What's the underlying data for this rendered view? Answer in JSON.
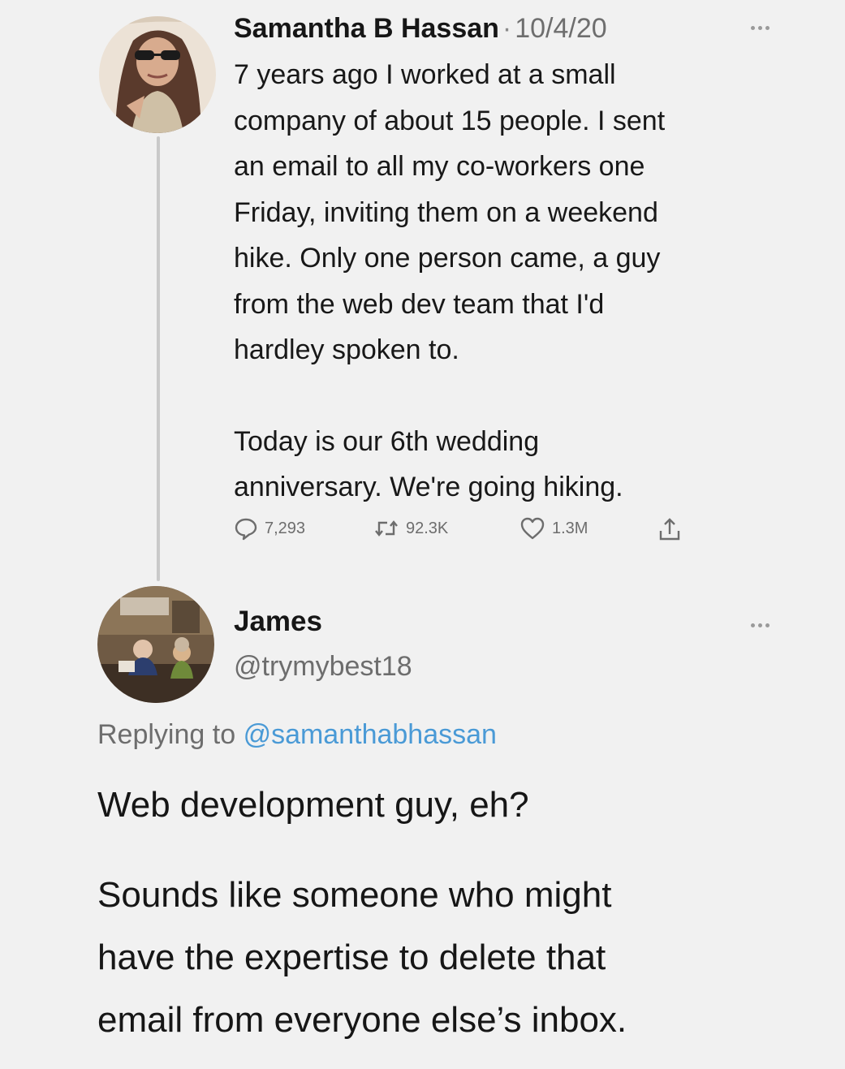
{
  "original_tweet": {
    "author": "Samantha B Hassan",
    "separator": "·",
    "date": "10/4/20",
    "text_lines": [
      "7 years ago I worked at a small",
      "company of about 15 people. I sent",
      "an email to all my co-workers one",
      "Friday, inviting them on a weekend",
      "hike. Only one person came, a guy",
      "from the web dev team that I'd",
      "hardley spoken to."
    ],
    "text_lines_2": [
      "Today is our 6th wedding",
      "anniversary. We're going hiking."
    ],
    "stats": {
      "replies": "7,293",
      "retweets": "92.3K",
      "likes": "1.3M"
    },
    "icons": [
      "reply-icon",
      "retweet-icon",
      "heart-icon",
      "share-icon",
      "more-icon"
    ]
  },
  "reply_tweet": {
    "name": "James",
    "handle": "@trymybest18",
    "replying_prefix": "Replying to",
    "replying_to": "@samanthabhassan",
    "text_line_1": "Web development guy, eh?",
    "text_lines_2": [
      "Sounds like someone who might",
      "have the expertise to delete that",
      "email from everyone else’s inbox."
    ]
  },
  "colors": {
    "background": "#f1f1f1",
    "text": "#181818",
    "muted": "#6d6d6d",
    "link": "#4a9ad6",
    "thread_line": "#c9c9c9"
  }
}
